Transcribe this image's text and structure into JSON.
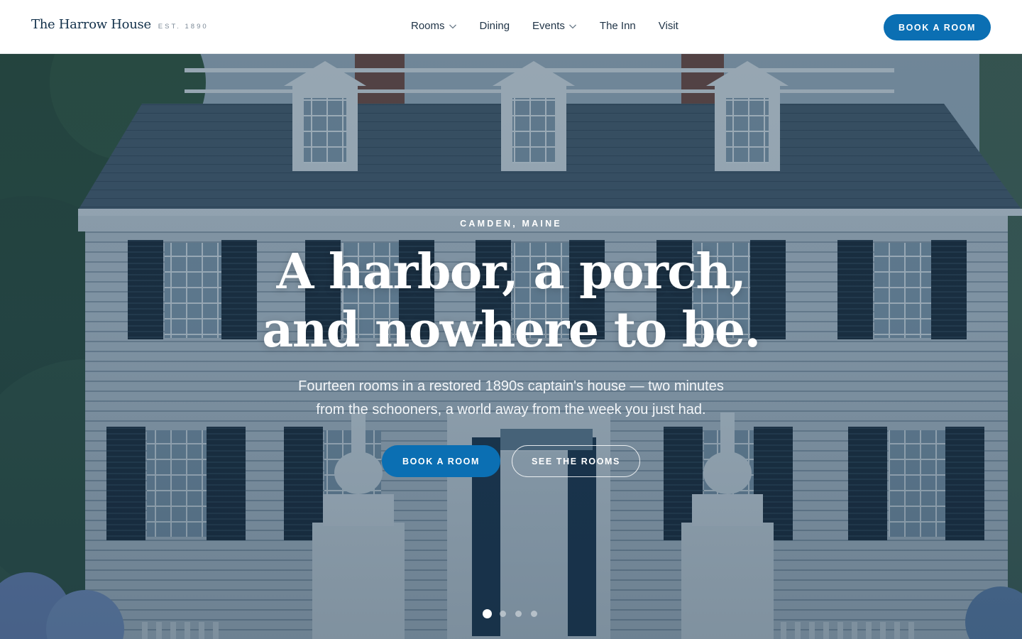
{
  "brand": {
    "name": "The Harrow House",
    "established": "EST. 1890"
  },
  "nav": {
    "items": [
      {
        "label": "Rooms",
        "has_dropdown": true
      },
      {
        "label": "Dining",
        "has_dropdown": false
      },
      {
        "label": "Events",
        "has_dropdown": true
      },
      {
        "label": "The Inn",
        "has_dropdown": false
      },
      {
        "label": "Visit",
        "has_dropdown": false
      }
    ],
    "cta_label": "BOOK A ROOM"
  },
  "hero": {
    "eyebrow": "CAMDEN, MAINE",
    "headline_line1": "A harbor, a porch,",
    "headline_line2": "and nowhere to be.",
    "subcopy_line1": "Fourteen rooms in a restored 1890s captain's house — two minutes",
    "subcopy_line2": "from the schooners, a world away from the week you just had.",
    "primary_cta": "BOOK A ROOM",
    "secondary_cta": "SEE THE ROOMS",
    "slides_count": 4,
    "active_slide": 1,
    "background_icon": "colonial-house-photo-icon"
  },
  "colors": {
    "brand_navy": "#12304a",
    "accent_blue": "#0b6fb3",
    "nav_text": "#1f3346",
    "overlay_navy": "#12344e"
  },
  "icons": {
    "dropdown": "chevron-down-icon"
  }
}
